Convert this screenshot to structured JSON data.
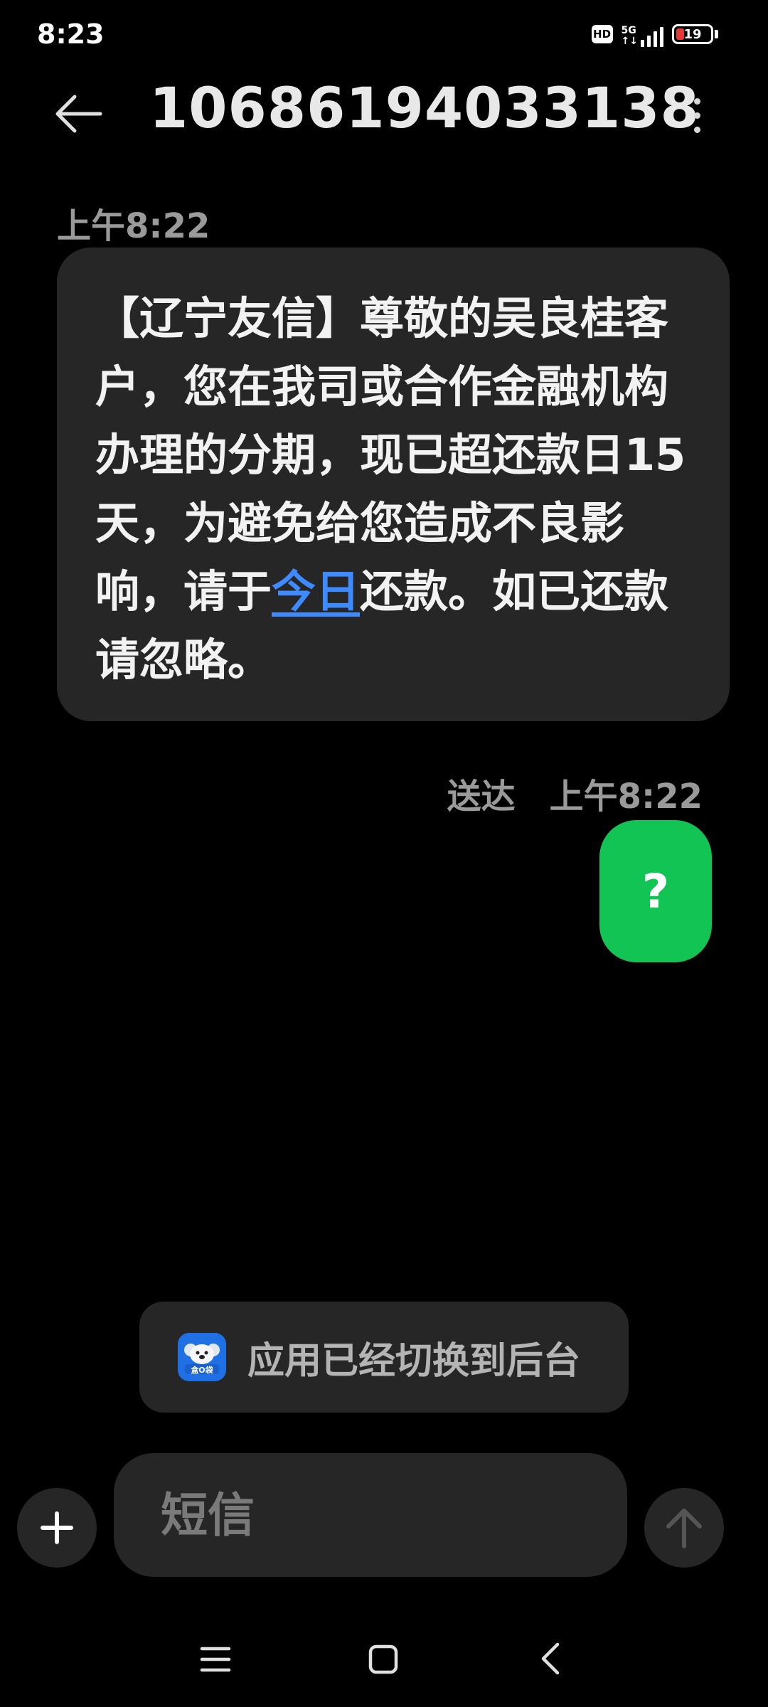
{
  "status_bar": {
    "time": "8:23",
    "hd": "HD",
    "network": "5G",
    "battery_level": "19",
    "battery_color": "#e53935"
  },
  "header": {
    "back_icon": "arrow-left-icon",
    "title": "10686194033138",
    "menu_icon": "more-vertical-icon"
  },
  "messages": {
    "incoming": {
      "time": "上午8:22",
      "text_before": "【辽宁友信】尊敬的吴良桂客户，您在我司或合作金融机构办理的分期，现已超还款日15天，为避免给您造成不良影响，请于",
      "link_text": "今日",
      "text_after": "还款。如已还款请忽略。"
    },
    "outgoing": {
      "status": "送达",
      "time": "上午8:22",
      "text": "?",
      "bubble_color": "#12c454"
    }
  },
  "toast": {
    "icon": "app-icon",
    "text": "应用已经切换到后台"
  },
  "composer": {
    "add_icon": "plus-icon",
    "placeholder": "短信",
    "value": "",
    "send_icon": "arrow-up-icon"
  },
  "nav_bar": {
    "menu_icon": "menu-icon",
    "home_icon": "home-square-icon",
    "back_icon": "chevron-left-icon"
  }
}
